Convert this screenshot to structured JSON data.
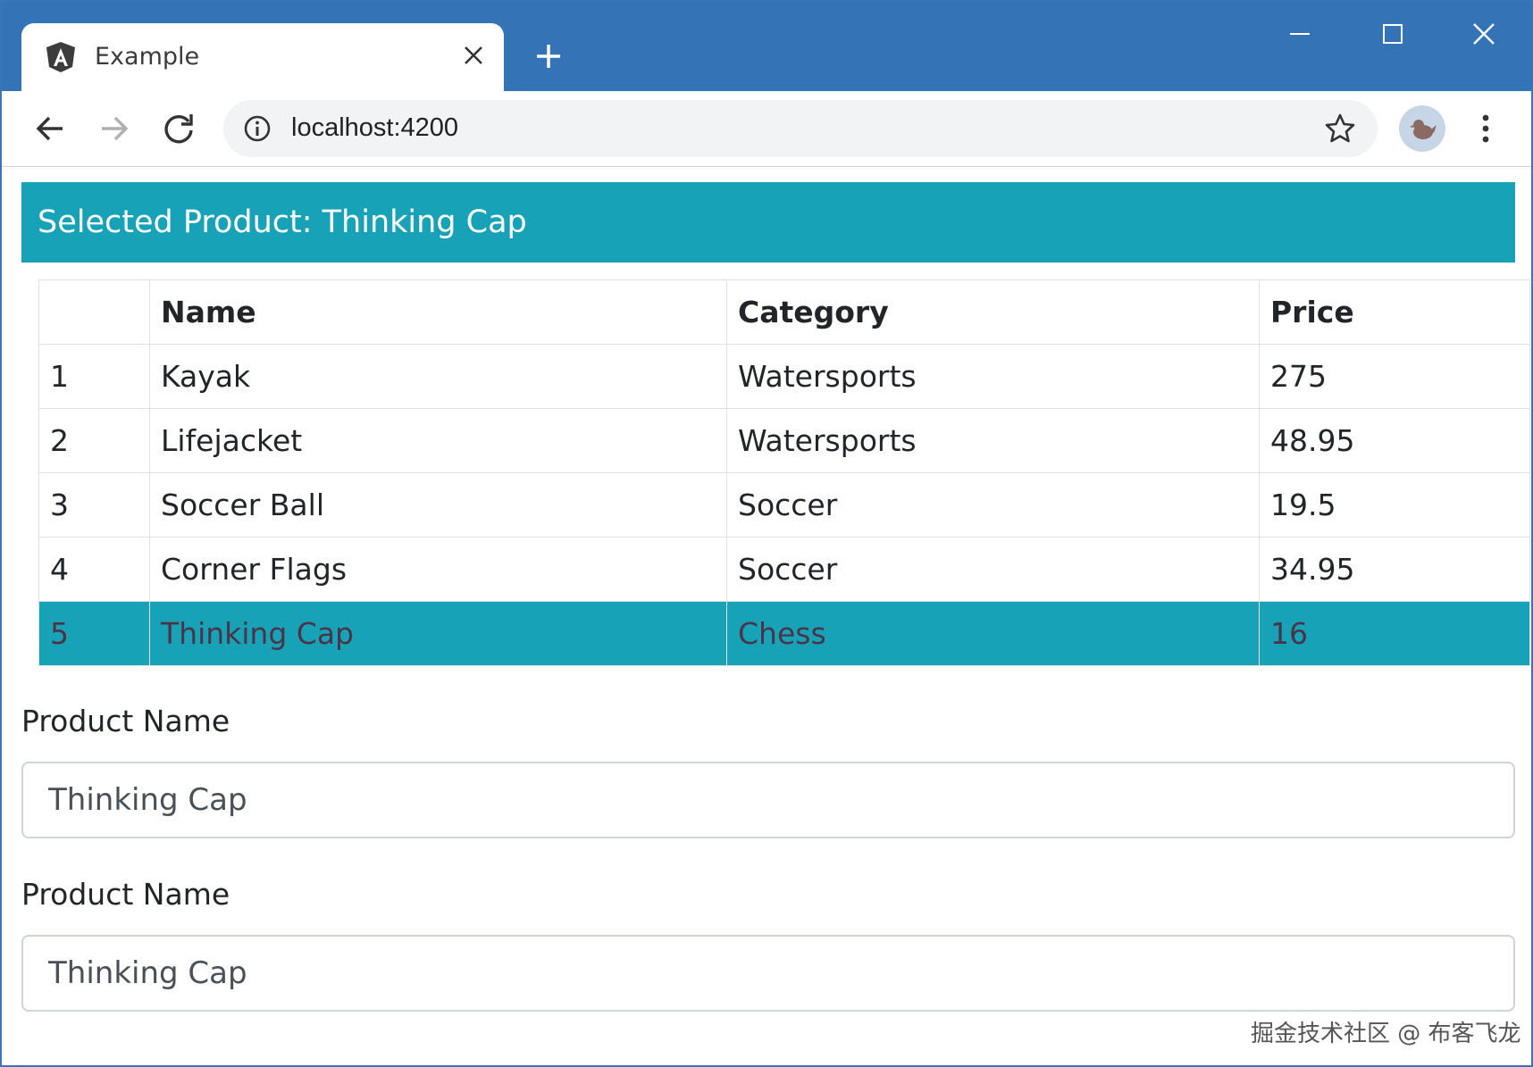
{
  "browser": {
    "tab_title": "Example",
    "url": "localhost:4200",
    "accent": "#3473b6",
    "favicon": "angular-icon"
  },
  "page": {
    "alert_text": "Selected Product: Thinking Cap",
    "alert_color": "#17a2b8",
    "table": {
      "headers": [
        "",
        "Name",
        "Category",
        "Price"
      ],
      "rows": [
        {
          "index": "1",
          "name": "Kayak",
          "category": "Watersports",
          "price": "275"
        },
        {
          "index": "2",
          "name": "Lifejacket",
          "category": "Watersports",
          "price": "48.95"
        },
        {
          "index": "3",
          "name": "Soccer Ball",
          "category": "Soccer",
          "price": "19.5"
        },
        {
          "index": "4",
          "name": "Corner Flags",
          "category": "Soccer",
          "price": "34.95"
        },
        {
          "index": "5",
          "name": "Thinking Cap",
          "category": "Chess",
          "price": "16"
        }
      ],
      "selected_row": 5
    },
    "fields": [
      {
        "label": "Product Name",
        "value": "Thinking Cap"
      },
      {
        "label": "Product Name",
        "value": "Thinking Cap"
      }
    ]
  },
  "watermark": "掘金技术社区 @ 布客飞龙"
}
